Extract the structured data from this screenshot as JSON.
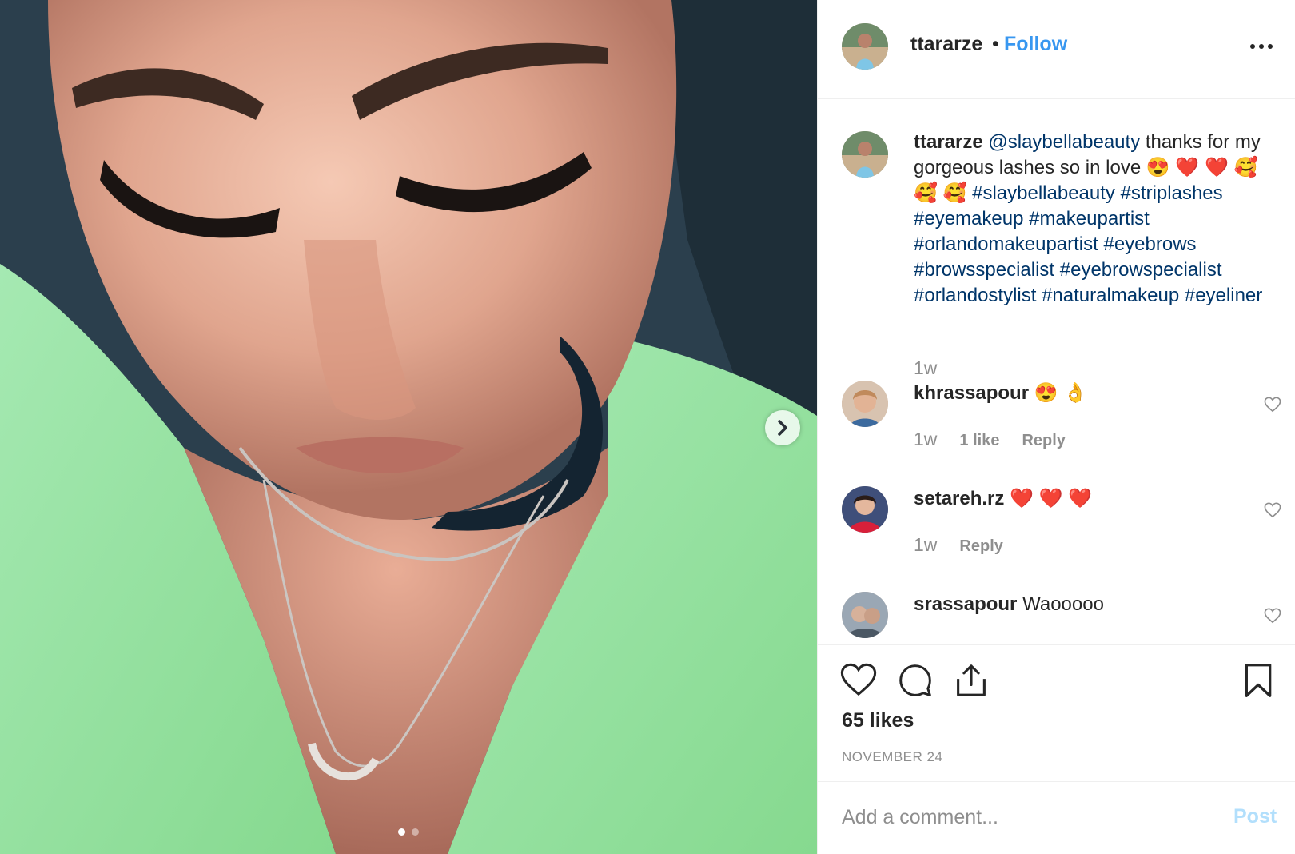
{
  "post": {
    "author": "ttararze",
    "separator": "•",
    "follow_label": "Follow",
    "more_icon": "more-options-icon"
  },
  "caption": {
    "username": "ttararze",
    "mention": "@slaybellabeauty",
    "text": " thanks for my gorgeous lashes so in love 😍 ❤️ ❤️ 🥰 🥰 🥰 ",
    "hashtags": "#slaybellabeauty #striplashes #eyemakeup #makeupartist #orlandomakeupartist #eyebrows #browsspecialist #eyebrowspecialist #orlandostylist #naturalmakeup #eyeliner",
    "time": "1w"
  },
  "comments": [
    {
      "username": "khrassapour",
      "text": "😍 👌",
      "time": "1w",
      "likes": "1 like",
      "reply": "Reply"
    },
    {
      "username": "setareh.rz",
      "text": "❤️ ❤️ ❤️",
      "time": "1w",
      "reply": "Reply"
    },
    {
      "username": "srassapour",
      "text": "Waooooo"
    }
  ],
  "actions": {
    "likes": "65 likes",
    "date": "NOVEMBER 24"
  },
  "add_comment": {
    "placeholder": "Add a comment...",
    "post_label": "Post"
  },
  "carousel": {
    "current": 1,
    "total": 2
  },
  "colors": {
    "link": "#003569",
    "follow": "#3897f0",
    "muted": "#8e8e8e",
    "post_disabled": "#b2dffc"
  }
}
